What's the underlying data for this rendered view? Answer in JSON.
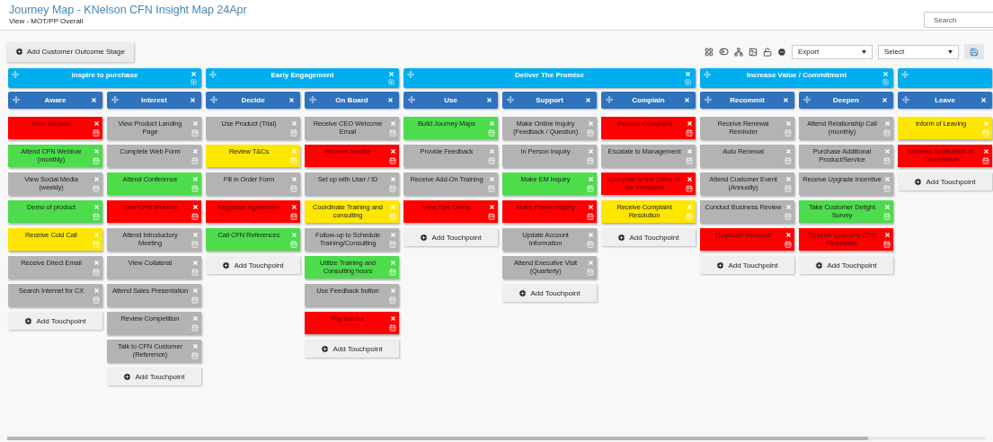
{
  "header": {
    "title": "Journey Map - KNelson CFN Insight Map 24Apr",
    "subtitle": "View - MOT/PP Overall"
  },
  "search": {
    "placeholder": "Search"
  },
  "toolbar": {
    "add_stage": "Add Customer Outcome Stage",
    "export": {
      "value": "Export"
    },
    "select": {
      "value": "Select"
    }
  },
  "stages": [
    {
      "title": "Inspire to purchase",
      "columns": [
        {
          "title": "Aware",
          "add_label": "Add Touchpoint",
          "cards": [
            {
              "label": "View Website",
              "color": "#ff0000"
            },
            {
              "label": "Attend CFN Webinar (monthly)",
              "color": "#4cdc4c"
            },
            {
              "label": "View Social Media (weekly)",
              "color": "#b3b3b3"
            },
            {
              "label": "Demo of product",
              "color": "#4cdc4c"
            },
            {
              "label": "Receive Cold Call",
              "color": "#ffe600"
            },
            {
              "label": "Receive Direct Email",
              "color": "#b3b3b3"
            },
            {
              "label": "Search Internet for CX",
              "color": "#b3b3b3"
            }
          ]
        },
        {
          "title": "Interest",
          "add_label": "Add Touchpoint",
          "cards": [
            {
              "label": "View Product Landing Page",
              "color": "#b3b3b3"
            },
            {
              "label": "Complete Web Form",
              "color": "#b3b3b3"
            },
            {
              "label": "Attend Conference",
              "color": "#4cdc4c"
            },
            {
              "label": "View CFN Webinar",
              "color": "#ff0000"
            },
            {
              "label": "Attend Introductory Meeting",
              "color": "#b3b3b3"
            },
            {
              "label": "View Collateral",
              "color": "#b3b3b3"
            },
            {
              "label": "Attend Sales Presentation",
              "color": "#b3b3b3"
            },
            {
              "label": "Review Competition",
              "color": "#b3b3b3"
            },
            {
              "label": "Talk to CFN Customer (Reference)",
              "color": "#b3b3b3"
            }
          ]
        }
      ]
    },
    {
      "title": "Early Engagement",
      "columns": [
        {
          "title": "Decide",
          "add_label": "Add Touchpoint",
          "cards": [
            {
              "label": "Use Product (Trial)",
              "color": "#b3b3b3"
            },
            {
              "label": "Review T&Cs",
              "color": "#ffe600"
            },
            {
              "label": "Fill in Order Form",
              "color": "#b3b3b3"
            },
            {
              "label": "Negotiate Agreement",
              "color": "#ff0000"
            },
            {
              "label": "Call CFN References",
              "color": "#4cdc4c"
            }
          ]
        },
        {
          "title": "On Board",
          "add_label": "Add Touchpoint",
          "cards": [
            {
              "label": "Receive CEO Welcome Email",
              "color": "#b3b3b3"
            },
            {
              "label": "Receive Invoice",
              "color": "#ff0000"
            },
            {
              "label": "Set up with User / ID",
              "color": "#b3b3b3"
            },
            {
              "label": "Coordinate Training and consulting",
              "color": "#ffe600"
            },
            {
              "label": "Follow-up to Schedule Training/Consulting",
              "color": "#b3b3b3"
            },
            {
              "label": "Utilize Training and Consulting hours",
              "color": "#4cdc4c"
            },
            {
              "label": "Use Feedback button",
              "color": "#b3b3b3"
            },
            {
              "label": "Pay Invoice",
              "color": "#ff0000"
            }
          ]
        }
      ]
    },
    {
      "title": "Deliver The Promise",
      "columns": [
        {
          "title": "Use",
          "add_label": "Add Touchpoint",
          "cards": [
            {
              "label": "Build Journey Maps",
              "color": "#4cdc4c"
            },
            {
              "label": "Provide Feedback",
              "color": "#b3b3b3"
            },
            {
              "label": "Receive Add-On Training",
              "color": "#b3b3b3"
            },
            {
              "label": "View Tips Online",
              "color": "#ff0000"
            }
          ]
        },
        {
          "title": "Support",
          "add_label": "Add Touchpoint",
          "cards": [
            {
              "label": "Make Online Inquiry (Feedback / Question)",
              "color": "#b3b3b3"
            },
            {
              "label": "In Person Inquiry",
              "color": "#b3b3b3"
            },
            {
              "label": "Make EM Inquiry",
              "color": "#4cdc4c"
            },
            {
              "label": "Make Phone Inquiry",
              "color": "#ff0000"
            },
            {
              "label": "Update Account Information",
              "color": "#b3b3b3"
            },
            {
              "label": "Attend Executive Visit (Quarterly)",
              "color": "#b3b3b3"
            }
          ]
        },
        {
          "title": "Complain",
          "add_label": "Add Touchpoint",
          "cards": [
            {
              "label": "Receive Complaint",
              "color": "#ff0000"
            },
            {
              "label": "Escalate to Management",
              "color": "#b3b3b3"
            },
            {
              "label": "Complain to the Office of the President",
              "color": "#ff0000"
            },
            {
              "label": "Receive Complaint Resolution",
              "color": "#ffe600"
            }
          ]
        }
      ]
    },
    {
      "title": "Increase Value / Commitment",
      "columns": [
        {
          "title": "Recommit",
          "add_label": "Add Touchpoint",
          "cards": [
            {
              "label": "Receive Renewal Reminder",
              "color": "#b3b3b3"
            },
            {
              "label": "Auto Renewal",
              "color": "#b3b3b3"
            },
            {
              "label": "Attend Customer Event (Annually)",
              "color": "#b3b3b3"
            },
            {
              "label": "Conduct Business Review",
              "color": "#b3b3b3"
            },
            {
              "label": "Negotiate Renewal",
              "color": "#ff0000"
            }
          ]
        },
        {
          "title": "Deepen",
          "add_label": "Add Touchpoint",
          "cards": [
            {
              "label": "Attend Relationship Call (monthly)",
              "color": "#b3b3b3"
            },
            {
              "label": "Purchase Additional Product/Service",
              "color": "#b3b3b3"
            },
            {
              "label": "Receive Upgrade Incentive",
              "color": "#b3b3b3"
            },
            {
              "label": "Take Customer Delight Survey",
              "color": "#4cdc4c"
            },
            {
              "label": "Receive Quarterly CFN Newsletter",
              "color": "#ff0000"
            }
          ]
        }
      ]
    },
    {
      "columns": [
        {
          "title": "Leave",
          "add_label": "Add Touchpoint",
          "cards": [
            {
              "label": "Inform of Leaving",
              "color": "#ffe600"
            },
            {
              "label": "Receive Notification of Cancellation",
              "color": "#ff0000"
            }
          ]
        }
      ]
    }
  ]
}
